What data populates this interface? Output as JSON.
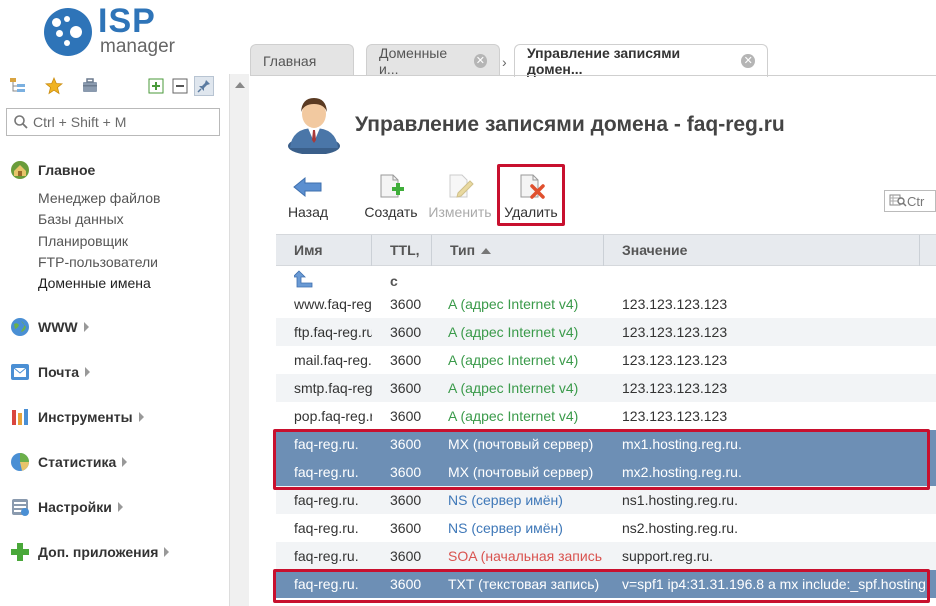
{
  "app": {
    "logo_main": "ISP",
    "logo_sub": "manager"
  },
  "sidebar": {
    "search_placeholder": "Ctrl + Shift + M",
    "sections": [
      {
        "label": "Главное",
        "icon": "home-icon"
      },
      {
        "label": "WWW",
        "icon": "globe-icon"
      },
      {
        "label": "Почта",
        "icon": "mail-icon"
      },
      {
        "label": "Инструменты",
        "icon": "tools-icon"
      },
      {
        "label": "Статистика",
        "icon": "chart-icon"
      },
      {
        "label": "Настройки",
        "icon": "settings-icon"
      },
      {
        "label": "Доп. приложения",
        "icon": "plus-icon"
      }
    ],
    "main_items": [
      "Менеджер файлов",
      "Базы данных",
      "Планировщик",
      "FTP-пользователи",
      "Доменные имена"
    ]
  },
  "tabs": [
    {
      "label": "Главная"
    },
    {
      "label": "Доменные и..."
    },
    {
      "label": "Управление записями домен..."
    }
  ],
  "page": {
    "title": "Управление записями домена - faq-reg.ru"
  },
  "toolbar": {
    "back": "Назад",
    "create": "Создать",
    "edit": "Изменить",
    "delete": "Удалить",
    "search_hint": "Ctr"
  },
  "table": {
    "headers": [
      "Имя",
      "TTL, c",
      "Тип",
      "Значение"
    ],
    "rows": [
      {
        "name": "www.faq-reg",
        "ttl": "3600",
        "type": "A (адрес Internet v4)",
        "kind": "a",
        "value": "123.123.123.123"
      },
      {
        "name": "ftp.faq-reg.ru",
        "ttl": "3600",
        "type": "A (адрес Internet v4)",
        "kind": "a",
        "value": "123.123.123.123"
      },
      {
        "name": "mail.faq-reg.r",
        "ttl": "3600",
        "type": "A (адрес Internet v4)",
        "kind": "a",
        "value": "123.123.123.123"
      },
      {
        "name": "smtp.faq-reg",
        "ttl": "3600",
        "type": "A (адрес Internet v4)",
        "kind": "a",
        "value": "123.123.123.123"
      },
      {
        "name": "pop.faq-reg.r",
        "ttl": "3600",
        "type": "A (адрес Internet v4)",
        "kind": "a",
        "value": "123.123.123.123"
      },
      {
        "name": "faq-reg.ru.",
        "ttl": "3600",
        "type": "MX (почтовый сервер)",
        "kind": "mx",
        "value": "mx1.hosting.reg.ru."
      },
      {
        "name": "faq-reg.ru.",
        "ttl": "3600",
        "type": "MX (почтовый сервер)",
        "kind": "mx",
        "value": "mx2.hosting.reg.ru."
      },
      {
        "name": "faq-reg.ru.",
        "ttl": "3600",
        "type": "NS (сервер имён)",
        "kind": "ns",
        "value": "ns1.hosting.reg.ru."
      },
      {
        "name": "faq-reg.ru.",
        "ttl": "3600",
        "type": "NS (сервер имён)",
        "kind": "ns",
        "value": "ns2.hosting.reg.ru."
      },
      {
        "name": "faq-reg.ru.",
        "ttl": "3600",
        "type": "SOA (начальная запись",
        "kind": "soa",
        "value": "support.reg.ru."
      },
      {
        "name": "faq-reg.ru.",
        "ttl": "3600",
        "type": "TXT (текстовая запись)",
        "kind": "txt",
        "value": "v=spf1 ip4:31.31.196.8 a mx include:_spf.hosting"
      }
    ]
  },
  "colors": {
    "brand": "#2e74b8",
    "selected_row": "#6d8fb5",
    "highlight": "#c8102e",
    "type_a": "#3a9a4a",
    "type_ns": "#3f78b8",
    "type_soa": "#d9534f"
  }
}
